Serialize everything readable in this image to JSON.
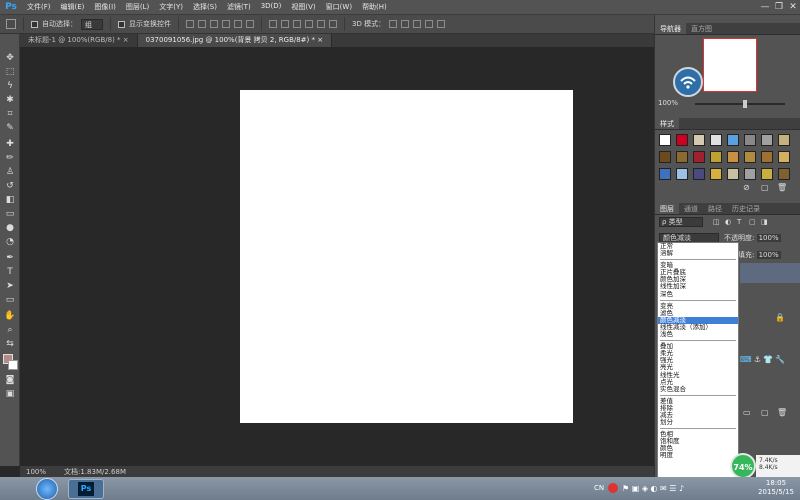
{
  "app": {
    "logo": "Ps"
  },
  "menu": {
    "items": [
      "文件(F)",
      "编辑(E)",
      "图像(I)",
      "图层(L)",
      "文字(Y)",
      "选择(S)",
      "滤镜(T)",
      "3D(D)",
      "视图(V)",
      "窗口(W)",
      "帮助(H)"
    ],
    "minimize": "—",
    "restore": "❐",
    "close": "✕"
  },
  "options": {
    "auto_select_label": "自动选择：",
    "auto_select_value": "组",
    "show_transform_label": "显示变换控件",
    "mode_3d_label": "3D 模式："
  },
  "tabs": [
    {
      "label": "未标题-1 @ 100%(RGB/8) *",
      "close": "×"
    },
    {
      "label": "0370091056.jpg @ 100%(背景 拷贝 2, RGB/8#) *",
      "close": "×"
    }
  ],
  "status": {
    "zoom": "100%",
    "doc": "文档:1.83M/2.68M"
  },
  "navigator": {
    "tab_nav": "导航器",
    "tab_hist": "直方图",
    "zoom": "100%"
  },
  "styles": {
    "tab": "样式"
  },
  "layers": {
    "tabs": [
      "图层",
      "通道",
      "路径",
      "历史记录"
    ],
    "kind_label": "ρ 类型",
    "blend_value": "颜色减淡",
    "opacity_label": "不透明度:",
    "opacity_value": "100%",
    "fill_label": "填充:",
    "fill_value": "100%"
  },
  "blend_modes": [
    [
      "正常",
      "溶解"
    ],
    [
      "变暗",
      "正片叠底",
      "颜色加深",
      "线性加深",
      "深色"
    ],
    [
      "变亮",
      "滤色",
      "颜色减淡",
      "线性减淡（添加）",
      "浅色"
    ],
    [
      "叠加",
      "柔光",
      "强光",
      "亮光",
      "线性光",
      "点光",
      "实色混合"
    ],
    [
      "差值",
      "排除",
      "减去",
      "划分"
    ],
    [
      "色相",
      "饱和度",
      "颜色",
      "明度"
    ]
  ],
  "blend_selected": "颜色减淡",
  "taskbar": {
    "time": "18:05",
    "date": "2015/5/15",
    "lang": "CN",
    "net_percent": "74%",
    "up_speed": "7.4K/s",
    "down_speed": "8.4K/s"
  }
}
